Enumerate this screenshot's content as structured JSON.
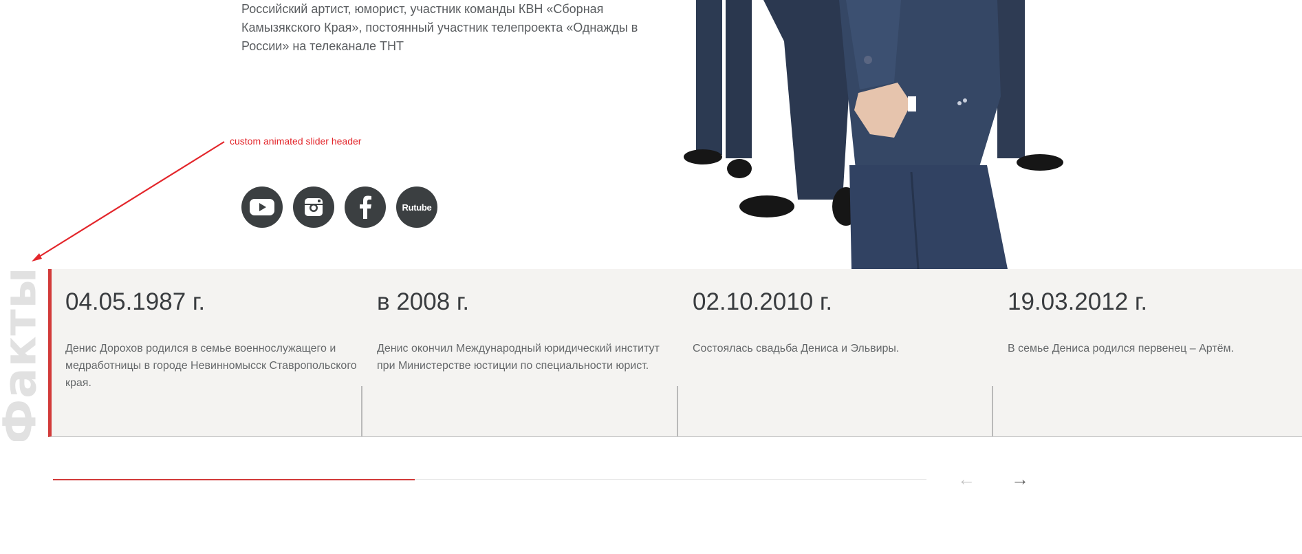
{
  "bio": {
    "text": "Российский артист, юморист, участник команды КВН «Сборная\nКамызякского Края», постоянный участник телепроекта «Однажды в\nРоссии» на телеканале ТНТ"
  },
  "annotation": {
    "text": "custom animated slider header",
    "color": "#e3262b"
  },
  "socials": [
    {
      "name": "youtube",
      "icon": "youtube-icon"
    },
    {
      "name": "instagram",
      "icon": "instagram-icon"
    },
    {
      "name": "facebook",
      "icon": "facebook-icon"
    },
    {
      "name": "rutube",
      "label": "Rutube"
    }
  ],
  "slider": {
    "header": "Факты",
    "accent_color": "#d23b3a",
    "progress": 0.414,
    "facts": [
      {
        "date": "04.05.1987 г.",
        "text": "Денис Дорохов родился в семье военнослужащего и медработницы в городе Невинномысск Ставропольского края."
      },
      {
        "date": "в 2008 г.",
        "text": "Денис окончил Международный юридический институт при Министерстве юстиции по специальности юрист."
      },
      {
        "date": "02.10.2010 г.",
        "text": "Состоялась свадьба Дениса и Эльвиры."
      },
      {
        "date": "19.03.2012 г.",
        "text": "В семье Дениса родился первенец – Артём."
      }
    ],
    "prev_label": "←",
    "next_label": "→"
  }
}
